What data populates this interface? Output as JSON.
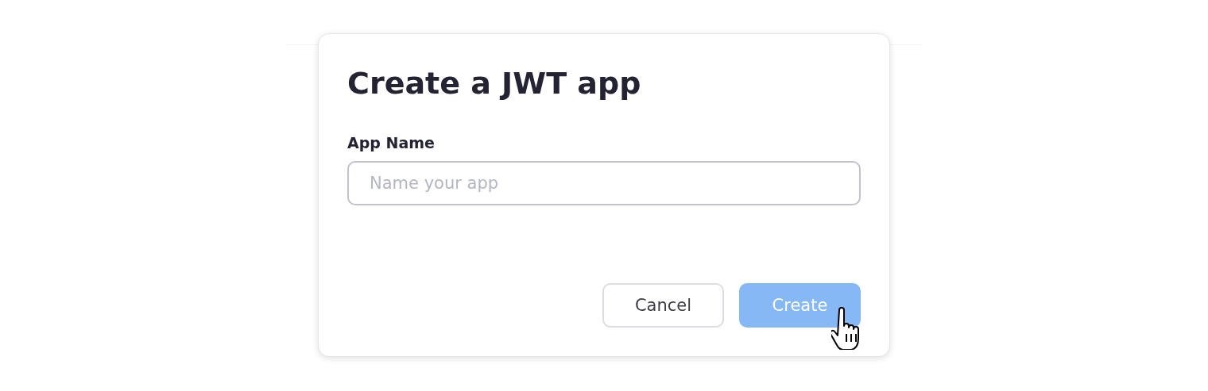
{
  "dialog": {
    "title": "Create a JWT app",
    "field": {
      "label": "App Name",
      "placeholder": "Name your app"
    },
    "buttons": [
      {
        "kind": "secondary",
        "label": "Cancel",
        "disabled": false
      },
      {
        "kind": "primary",
        "label": "Create",
        "disabled": true
      }
    ]
  }
}
